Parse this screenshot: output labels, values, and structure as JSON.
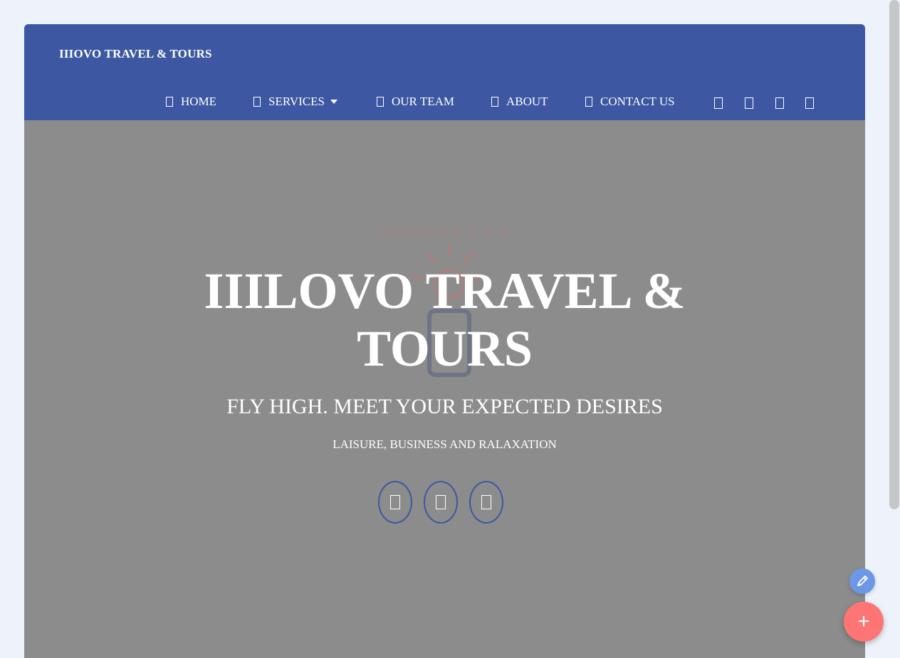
{
  "header": {
    "brand": "IIIOVO TRAVEL & TOURS"
  },
  "nav": {
    "items": [
      {
        "label": "HOME",
        "icon": "home-icon"
      },
      {
        "label": "SERVICES",
        "icon": "services-icon",
        "dropdown": true
      },
      {
        "label": "OUR TEAM",
        "icon": "team-icon"
      },
      {
        "label": "ABOUT",
        "icon": "about-icon"
      },
      {
        "label": "CONTACT US",
        "icon": "contact-icon"
      }
    ],
    "social_icons": [
      "social-icon-1",
      "social-icon-2",
      "social-icon-3",
      "social-icon-4"
    ]
  },
  "hero": {
    "watermark": "MOBIRISE  5.8.0",
    "title_line1": "IIILOVO TRAVEL &",
    "title_line2": "TOURS",
    "subtitle": "FLY HIGH. MEET YOUR EXPECTED DESIRES",
    "tagline": "LAISURE, BUSINESS AND RALAXATION",
    "buttons": [
      "hero-icon-1",
      "hero-icon-2",
      "hero-icon-3"
    ]
  },
  "colors": {
    "page_bg": "#eef2fb",
    "navbar": "#3d57a2",
    "hero_bg": "#8c8c8c",
    "fab_add": "#ff7474",
    "fab_edit": "#6b97e4"
  },
  "fab": {
    "add_symbol": "+"
  }
}
